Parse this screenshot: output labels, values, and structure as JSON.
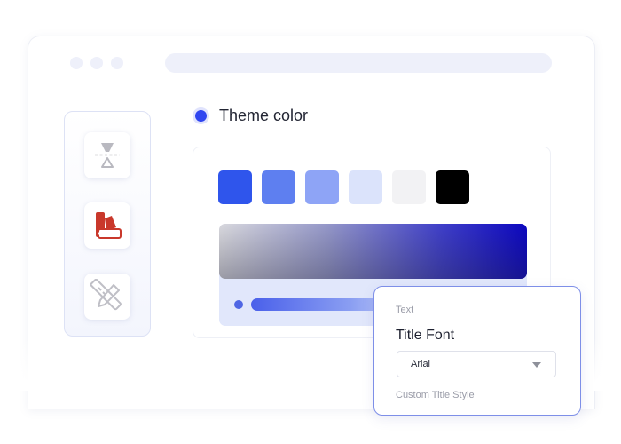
{
  "theme_section": {
    "title": "Theme color",
    "swatches": [
      {
        "name": "blue-primary",
        "color": "#2f55ec"
      },
      {
        "name": "blue-medium",
        "color": "#5e7ff0"
      },
      {
        "name": "blue-light",
        "color": "#8ea4f6"
      },
      {
        "name": "blue-pale",
        "color": "#dbe3fb"
      },
      {
        "name": "gray-light",
        "color": "#f2f2f4"
      },
      {
        "name": "black",
        "color": "#000000"
      }
    ],
    "accent_color": "#2f45f0"
  },
  "sidebar": {
    "items": [
      {
        "icon": "ruler-icon"
      },
      {
        "icon": "color-palette-icon"
      },
      {
        "icon": "design-tools-icon"
      }
    ]
  },
  "text_card": {
    "label": "Text",
    "title": "Title Font",
    "font_select": {
      "value": "Arial"
    },
    "hint": "Custom Title Style"
  }
}
